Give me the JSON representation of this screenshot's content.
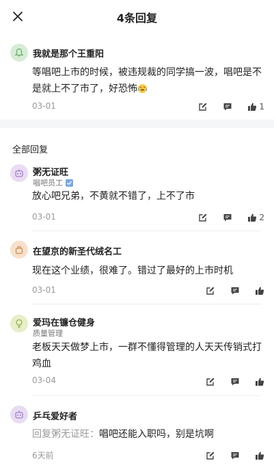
{
  "header": {
    "title": "4条回复"
  },
  "main_comment": {
    "username": "我就是那个王重阳",
    "text": "等唱吧上市的时候，被违规裁的同学搞一波，唱吧是不是就上不了市了，好恐怖",
    "emoji_icon": "laughing-crying-face",
    "date": "03-01",
    "like_count": "1"
  },
  "section_title": "全部回复",
  "replies": [
    {
      "username": "粥无证旺",
      "subtitle": "唱吧员工",
      "text": "放心吧兄弟，不黄就不错了，上不了市",
      "date": "03-01",
      "like_count": "2"
    },
    {
      "username": "在望京的新圣代绒名工",
      "text": "现在这个业绩，很难了。错过了最好的上市时机",
      "date": "03-01",
      "like_count": ""
    },
    {
      "username": "爱玛在镰仓健身",
      "subtitle": "质量管理",
      "text": "老板天天做梦上市，一群不懂得管理的人天天传销式打鸡血",
      "date": "03-04",
      "like_count": ""
    },
    {
      "username": "乒乓爱好者",
      "reply_prefix": "回复粥无证旺：",
      "text": "唱吧还能入职吗，别是坑啊",
      "date": "6天前",
      "like_count": ""
    }
  ],
  "colors": {
    "avatar_green": "#d6ecd6",
    "avatar_purple": "#e9dcf3",
    "avatar_orange": "#f7e0cc",
    "avatar_olive": "#e6efc9",
    "avatar_lilac": "#e7dcf2"
  }
}
